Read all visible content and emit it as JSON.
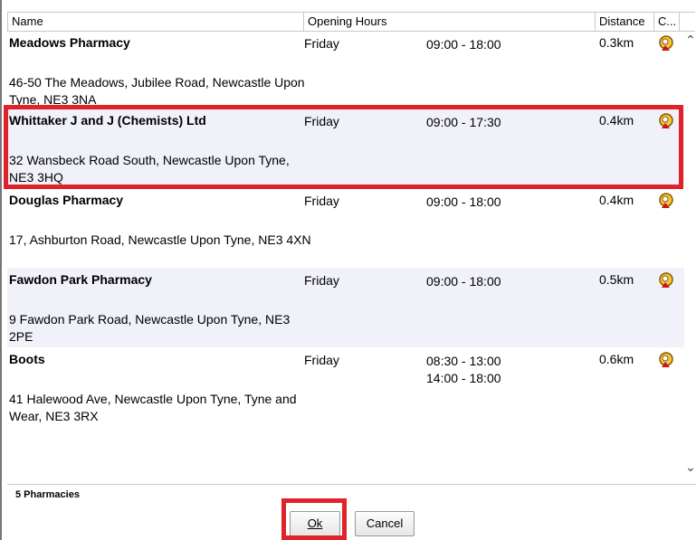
{
  "columns": {
    "name": "Name",
    "opening_hours": "Opening Hours",
    "distance": "Distance",
    "c": "C..."
  },
  "pharmacies": [
    {
      "name": "Meadows Pharmacy",
      "address": "46-50 The Meadows, Jubilee Road, Newcastle Upon Tyne, NE3 3NA",
      "day": "Friday",
      "hours": [
        "09:00 - 18:00"
      ],
      "distance": "0.3km",
      "icon": "pharmacist-icon"
    },
    {
      "name": "Whittaker J and J (Chemists) Ltd",
      "address": "32 Wansbeck Road South, Newcastle Upon Tyne, NE3 3HQ",
      "day": "Friday",
      "hours": [
        "09:00 - 17:30"
      ],
      "distance": "0.4km",
      "icon": "pharmacist-icon"
    },
    {
      "name": "Douglas Pharmacy",
      "address": "17, Ashburton Road, Newcastle Upon Tyne, NE3 4XN",
      "day": "Friday",
      "hours": [
        "09:00 - 18:00"
      ],
      "distance": "0.4km",
      "icon": "pharmacist-icon"
    },
    {
      "name": "Fawdon Park Pharmacy",
      "address": "9 Fawdon Park Road, Newcastle Upon Tyne, NE3 2PE",
      "day": "Friday",
      "hours": [
        "09:00 - 18:00"
      ],
      "distance": "0.5km",
      "icon": "pharmacist-icon"
    },
    {
      "name": "Boots",
      "address": "41 Halewood Ave, Newcastle Upon Tyne, Tyne and Wear, NE3 3RX",
      "day": "Friday",
      "hours": [
        "08:30 - 13:00",
        "14:00 - 18:00"
      ],
      "distance": "0.6km",
      "icon": "pharmacist-icon"
    }
  ],
  "footer": {
    "count": "5 Pharmacies",
    "ok_label": "Ok",
    "cancel_label": "Cancel"
  },
  "colors": {
    "highlight": "#e0222a",
    "alt_row": "#f0f1f9"
  }
}
